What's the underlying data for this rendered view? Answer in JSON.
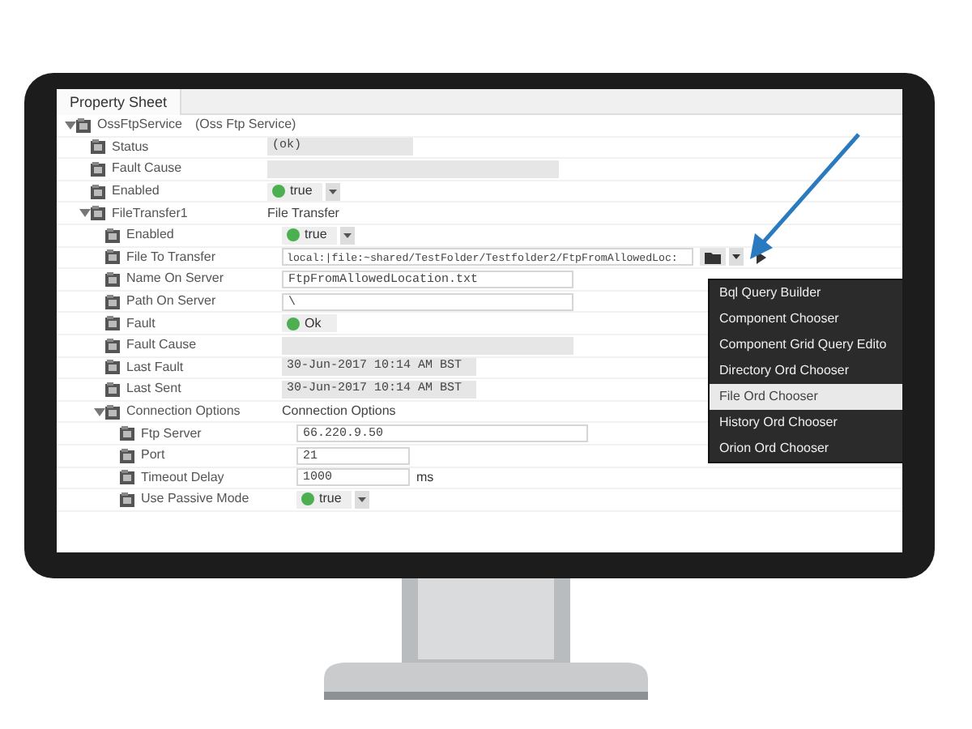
{
  "panel": {
    "title": "Property Sheet"
  },
  "tree": {
    "label": "OssFtpService",
    "type": "(Oss Ftp Service)",
    "expanded": true,
    "children": [
      {
        "label": "Status",
        "kind": "readonly",
        "value": "(ok)"
      },
      {
        "label": "Fault Cause",
        "kind": "readonly-long"
      },
      {
        "label": "Enabled",
        "kind": "bool",
        "value": "true",
        "on": true
      },
      {
        "label": "FileTransfer1",
        "kind": "type",
        "value": "File Transfer",
        "expanded": true,
        "children": [
          {
            "label": "Enabled",
            "kind": "bool",
            "value": "true",
            "on": true
          },
          {
            "label": "File To Transfer",
            "kind": "file",
            "value": "local:|file:~shared/TestFolder/Testfolder2/FtpFromAllowedLoc:"
          },
          {
            "label": "Name On Server",
            "kind": "field",
            "value": "FtpFromAllowedLocation.txt"
          },
          {
            "label": "Path On Server",
            "kind": "field",
            "value": "\\"
          },
          {
            "label": "Fault",
            "kind": "status",
            "value": "Ok",
            "on": true
          },
          {
            "label": "Fault Cause",
            "kind": "readonly-long"
          },
          {
            "label": "Last Fault",
            "kind": "readonly-mid",
            "value": "30-Jun-2017 10:14 AM BST"
          },
          {
            "label": "Last Sent",
            "kind": "readonly-mid",
            "value": "30-Jun-2017 10:14 AM BST"
          },
          {
            "label": "Connection Options",
            "kind": "type",
            "value": "Connection Options",
            "expanded": true,
            "children": [
              {
                "label": "Ftp Server",
                "kind": "field",
                "value": "66.220.9.50"
              },
              {
                "label": "Port",
                "kind": "field-short",
                "value": "21"
              },
              {
                "label": "Timeout Delay",
                "kind": "field-short",
                "value": "1000",
                "unit": "ms"
              },
              {
                "label": "Use Passive Mode",
                "kind": "bool",
                "value": "true",
                "on": true
              }
            ]
          }
        ]
      }
    ]
  },
  "menu": {
    "items": [
      {
        "label": "Bql Query Builder",
        "selected": false
      },
      {
        "label": "Component Chooser",
        "selected": false
      },
      {
        "label": "Component Grid Query Edito",
        "selected": false
      },
      {
        "label": "Directory Ord Chooser",
        "selected": false
      },
      {
        "label": "File Ord Chooser",
        "selected": true
      },
      {
        "label": "History Ord Chooser",
        "selected": false
      },
      {
        "label": "Orion Ord Chooser",
        "selected": false
      }
    ]
  }
}
